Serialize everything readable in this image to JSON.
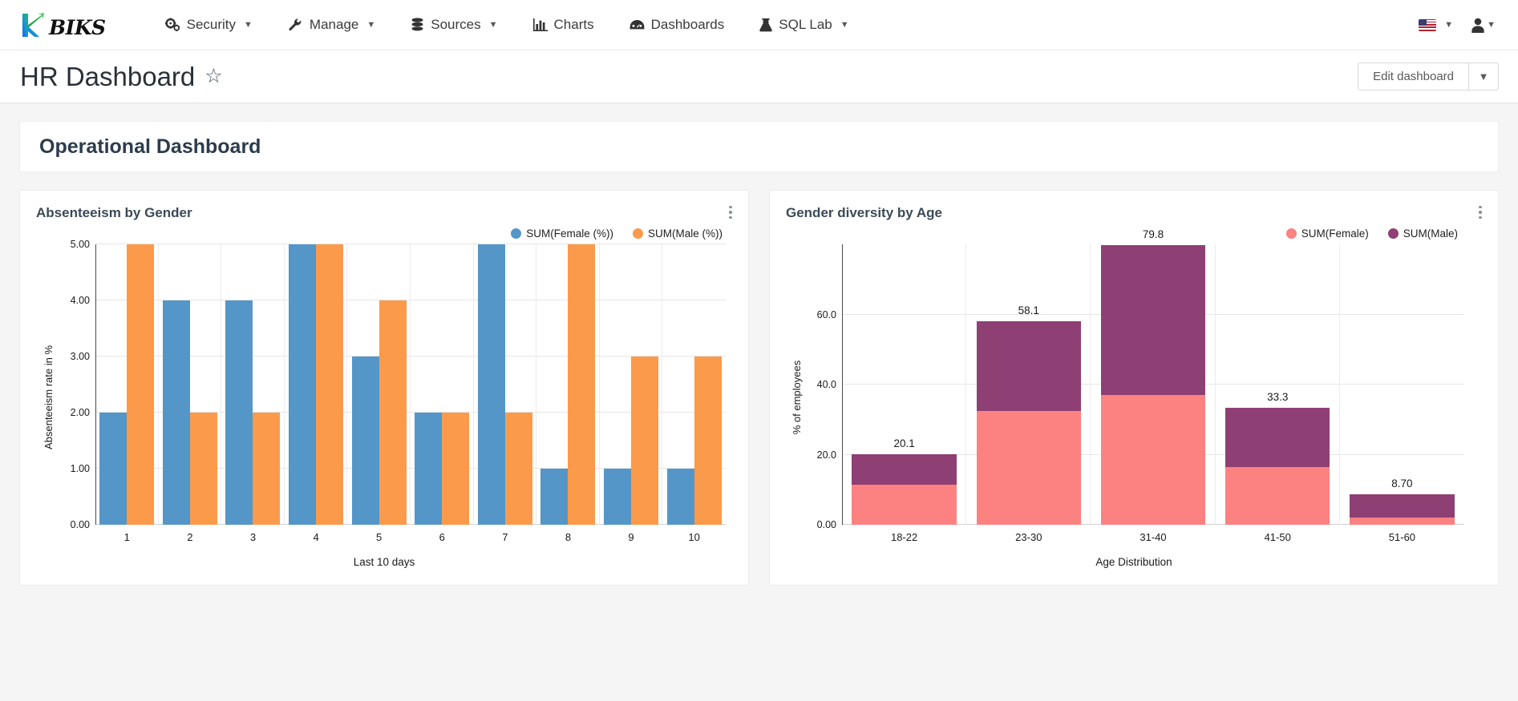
{
  "navbar": {
    "brand_word": "BIKS",
    "items": [
      {
        "label": "Security",
        "icon": "gears-icon",
        "caret": true
      },
      {
        "label": "Manage",
        "icon": "wrench-icon",
        "caret": true
      },
      {
        "label": "Sources",
        "icon": "database-icon",
        "caret": true
      },
      {
        "label": "Charts",
        "icon": "bar-chart-icon",
        "caret": false
      },
      {
        "label": "Dashboards",
        "icon": "speedometer-icon",
        "caret": false
      },
      {
        "label": "SQL Lab",
        "icon": "flask-icon",
        "caret": true
      }
    ],
    "language_icon": "us-flag-icon",
    "user_icon": "user-icon"
  },
  "titlebar": {
    "title": "HR Dashboard",
    "favorite_icon": "star-outline-icon",
    "edit_button": "Edit dashboard",
    "edit_caret_icon": "chevron-down-icon"
  },
  "dashboard": {
    "header_title": "Operational Dashboard",
    "colors": {
      "female_blue": "#5596c8",
      "male_orange": "#fb9a4b",
      "female_pink": "#fc8181",
      "male_purple": "#8e3f73"
    }
  },
  "chart_data": [
    {
      "type": "bar",
      "title": "Absenteeism by Gender",
      "xlabel": "Last 10 days",
      "ylabel": "Absenteeism rate in %",
      "ylim": [
        0,
        5
      ],
      "yticks": [
        "0.00",
        "1.00",
        "2.00",
        "3.00",
        "4.00",
        "5.00"
      ],
      "grid": true,
      "legend_position": "top-right",
      "stacked": false,
      "categories": [
        "1",
        "2",
        "3",
        "4",
        "5",
        "6",
        "7",
        "8",
        "9",
        "10"
      ],
      "series": [
        {
          "name": "SUM(Female (%))",
          "color": "#5596c8",
          "values": [
            2.0,
            4.0,
            4.0,
            5.0,
            3.0,
            2.0,
            5.0,
            1.0,
            1.0,
            1.0
          ]
        },
        {
          "name": "SUM(Male (%))",
          "color": "#fb9a4b",
          "values": [
            5.0,
            2.0,
            2.0,
            5.0,
            4.0,
            2.0,
            2.0,
            5.0,
            3.0,
            3.0
          ]
        }
      ]
    },
    {
      "type": "bar",
      "title": "Gender diversity by Age",
      "xlabel": "Age Distribution",
      "ylabel": "% of employees",
      "ylim": [
        0,
        80
      ],
      "yticks": [
        "0.00",
        "20.0",
        "40.0",
        "60.0"
      ],
      "grid": true,
      "legend_position": "top-right",
      "stacked": true,
      "categories": [
        "18-22",
        "23-30",
        "31-40",
        "41-50",
        "51-60"
      ],
      "totals": [
        "20.1",
        "58.1",
        "79.8",
        "33.3",
        "8.70"
      ],
      "series": [
        {
          "name": "SUM(Female)",
          "color": "#fc8181",
          "values": [
            11.5,
            32.5,
            37.0,
            16.5,
            2.0
          ]
        },
        {
          "name": "SUM(Male)",
          "color": "#8e3f73",
          "values": [
            8.6,
            25.6,
            42.8,
            16.8,
            6.7
          ]
        }
      ]
    }
  ]
}
